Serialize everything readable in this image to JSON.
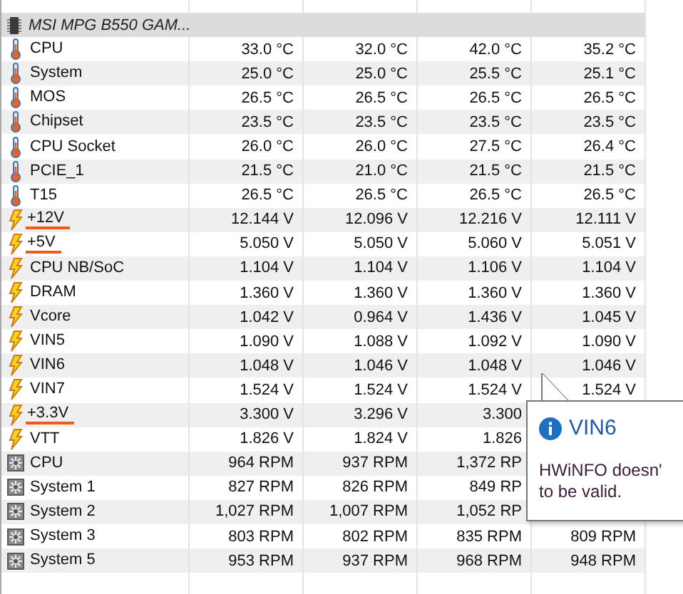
{
  "device": {
    "name": "MSI MPG B550 GAM..."
  },
  "sensors": [
    {
      "kind": "temperature",
      "label": "CPU",
      "underlined": false,
      "values": [
        "33.0 °C",
        "32.0 °C",
        "42.0 °C",
        "35.2 °C"
      ]
    },
    {
      "kind": "temperature",
      "label": "System",
      "underlined": false,
      "values": [
        "25.0 °C",
        "25.0 °C",
        "25.5 °C",
        "25.1 °C"
      ]
    },
    {
      "kind": "temperature",
      "label": "MOS",
      "underlined": false,
      "values": [
        "26.5 °C",
        "26.5 °C",
        "26.5 °C",
        "26.5 °C"
      ]
    },
    {
      "kind": "temperature",
      "label": "Chipset",
      "underlined": false,
      "values": [
        "23.5 °C",
        "23.5 °C",
        "23.5 °C",
        "23.5 °C"
      ]
    },
    {
      "kind": "temperature",
      "label": "CPU Socket",
      "underlined": false,
      "values": [
        "26.0 °C",
        "26.0 °C",
        "27.5 °C",
        "26.4 °C"
      ]
    },
    {
      "kind": "temperature",
      "label": "PCIE_1",
      "underlined": false,
      "values": [
        "21.5 °C",
        "21.0 °C",
        "21.5 °C",
        "21.5 °C"
      ]
    },
    {
      "kind": "temperature",
      "label": "T15",
      "underlined": false,
      "values": [
        "26.5 °C",
        "26.5 °C",
        "26.5 °C",
        "26.5 °C"
      ]
    },
    {
      "kind": "voltage",
      "label": "+12V",
      "underlined": true,
      "values": [
        "12.144 V",
        "12.096 V",
        "12.216 V",
        "12.111 V"
      ]
    },
    {
      "kind": "voltage",
      "label": "+5V",
      "underlined": true,
      "values": [
        "5.050 V",
        "5.050 V",
        "5.060 V",
        "5.051 V"
      ]
    },
    {
      "kind": "voltage",
      "label": "CPU NB/SoC",
      "underlined": false,
      "values": [
        "1.104 V",
        "1.104 V",
        "1.106 V",
        "1.104 V"
      ]
    },
    {
      "kind": "voltage",
      "label": "DRAM",
      "underlined": false,
      "values": [
        "1.360 V",
        "1.360 V",
        "1.360 V",
        "1.360 V"
      ]
    },
    {
      "kind": "voltage",
      "label": "Vcore",
      "underlined": false,
      "values": [
        "1.042 V",
        "0.964 V",
        "1.436 V",
        "1.045 V"
      ]
    },
    {
      "kind": "voltage",
      "label": "VIN5",
      "underlined": false,
      "values": [
        "1.090 V",
        "1.088 V",
        "1.092 V",
        "1.090 V"
      ]
    },
    {
      "kind": "voltage",
      "label": "VIN6",
      "underlined": false,
      "values": [
        "1.048 V",
        "1.046 V",
        "1.048 V",
        "1.046 V"
      ]
    },
    {
      "kind": "voltage",
      "label": "VIN7",
      "underlined": false,
      "values": [
        "1.524 V",
        "1.524 V",
        "1.524 V",
        "1.524 V"
      ]
    },
    {
      "kind": "voltage",
      "label": "+3.3V",
      "underlined": true,
      "values": [
        "3.300 V",
        "3.296 V",
        "3.300"
      ]
    },
    {
      "kind": "voltage",
      "label": "VTT",
      "underlined": false,
      "values": [
        "1.826 V",
        "1.824 V",
        "1.826"
      ]
    },
    {
      "kind": "fan",
      "label": "CPU",
      "underlined": false,
      "values": [
        "964 RPM",
        "937 RPM",
        "1,372 RP"
      ]
    },
    {
      "kind": "fan",
      "label": "System 1",
      "underlined": false,
      "values": [
        "827 RPM",
        "826 RPM",
        "849 RP"
      ]
    },
    {
      "kind": "fan",
      "label": "System 2",
      "underlined": false,
      "values": [
        "1,027 RPM",
        "1,007 RPM",
        "1,052 RP"
      ]
    },
    {
      "kind": "fan",
      "label": "System 3",
      "underlined": false,
      "values": [
        "803 RPM",
        "802 RPM",
        "835 RPM",
        "809 RPM"
      ]
    },
    {
      "kind": "fan",
      "label": "System 5",
      "underlined": false,
      "values": [
        "953 RPM",
        "937 RPM",
        "968 RPM",
        "948 RPM"
      ]
    }
  ],
  "tooltip": {
    "title": "VIN6",
    "lines": [
      "HWiNFO doesn'",
      "to be valid."
    ]
  }
}
